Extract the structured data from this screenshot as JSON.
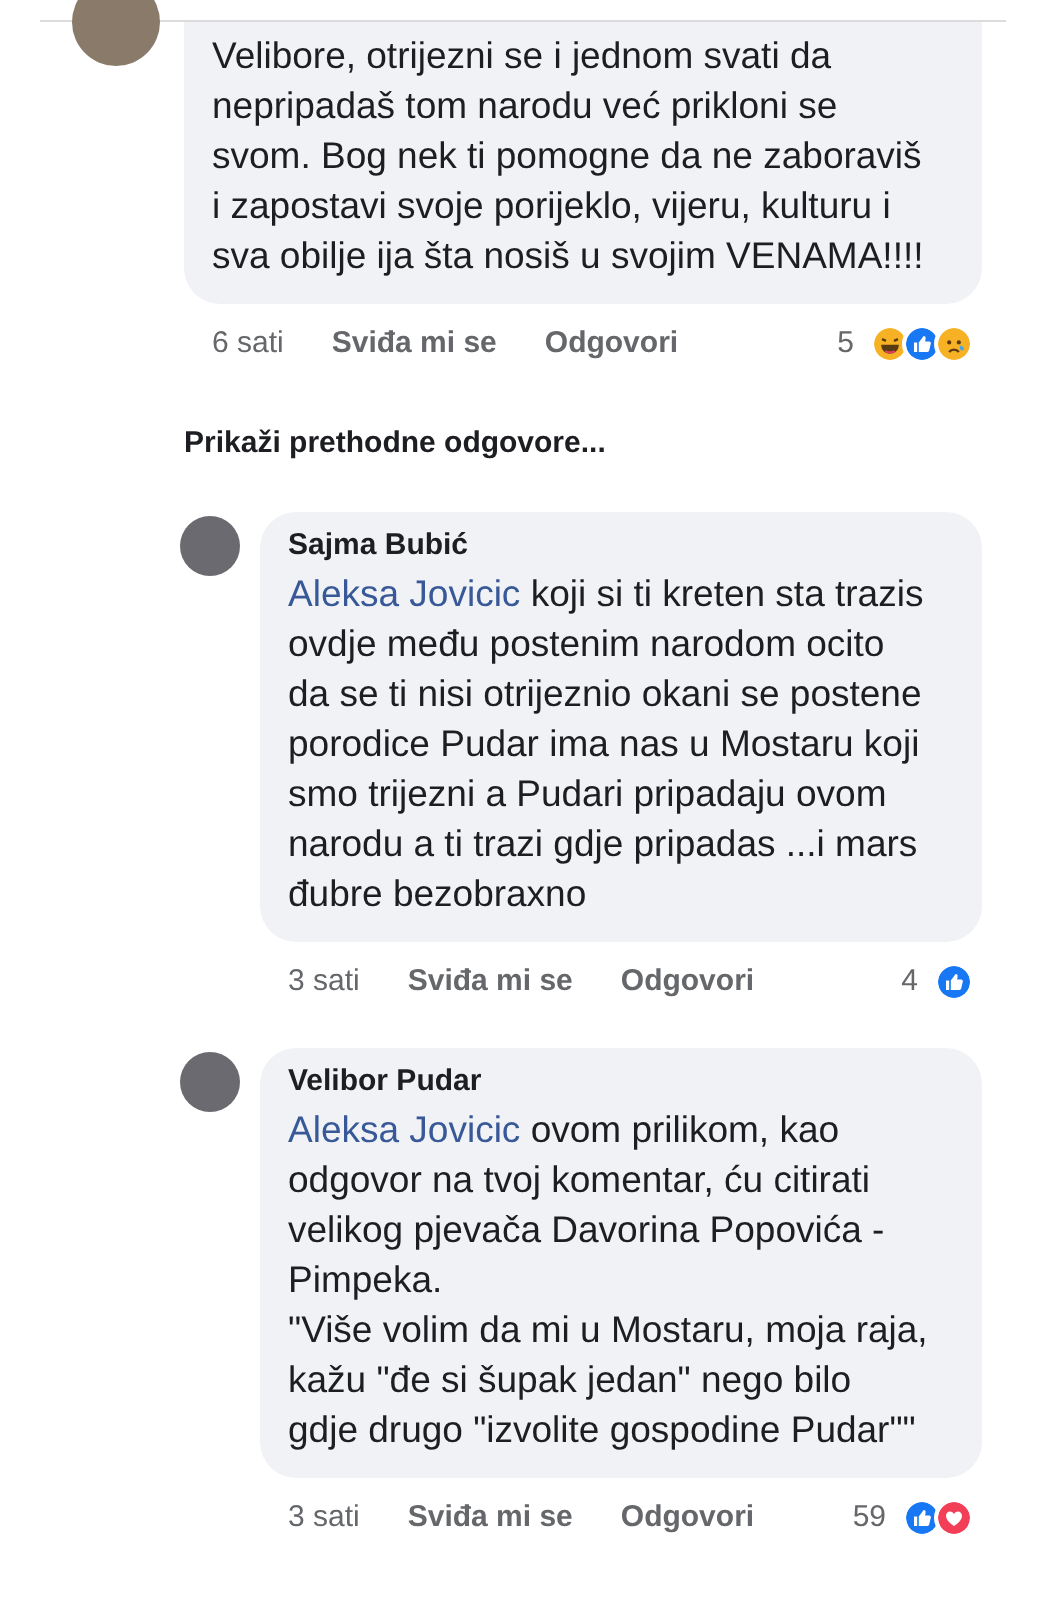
{
  "comments": [
    {
      "text": "Velibore, otrijezni se i jednom svati da nepripadaš tom narodu već prikloni se svom. Bog nek ti pomogne da ne zaboraviš i zapostavi svoje porijeklo, vijeru, kulturu i sva obilje ija šta nosiš u svojim VENAMA!!!!",
      "time": "6 sati",
      "like": "Sviđa mi se",
      "reply": "Odgovori",
      "count": "5",
      "reactions": [
        {
          "kind": "haha"
        },
        {
          "kind": "like"
        },
        {
          "kind": "sad"
        }
      ]
    },
    {
      "kind": "link",
      "label": "Prikaži prethodne odgovore..."
    },
    {
      "author": "Sajma Bubić",
      "mention": "Aleksa Jovicic",
      "text": "koji si ti kreten sta trazis ovdje među postenim narodom ocito da se ti nisi otrijeznio okani se postene porodice Pudar ima nas u Mostaru koji smo trijezni a Pudari pripadaju ovom narodu a ti trazi gdje pripadas ...i mars đubre bezobraxno",
      "time": "3 sati",
      "like": "Sviđa mi se",
      "reply": "Odgovori",
      "count": "4",
      "reactions": [
        {
          "kind": "like"
        }
      ]
    },
    {
      "author": "Velibor Pudar",
      "mention": "Aleksa Jovicic",
      "text": "ovom prilikom, kao odgovor na tvoj komentar, ću citirati velikog pjevača Davorina Popovića - Pimpeka.\n\"Više volim da mi u Mostaru, moja raja, kažu \"đe si šupak jedan\" nego bilo gdje drugo \"izvolite gospodine Pudar\"\"",
      "time": "3 sati",
      "like": "Sviđa mi se",
      "reply": "Odgovori",
      "count": "59",
      "reactions": [
        {
          "kind": "like"
        },
        {
          "kind": "love"
        }
      ]
    }
  ]
}
